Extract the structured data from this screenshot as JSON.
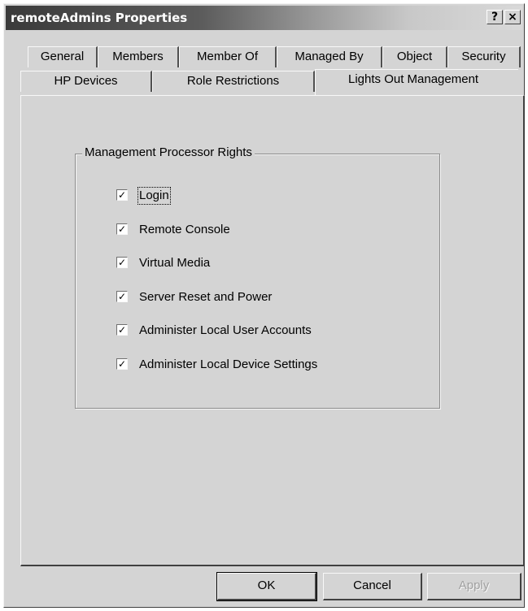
{
  "window": {
    "title": "remoteAdmins Properties",
    "help_label": "?",
    "close_label": "×"
  },
  "tabs": {
    "row1": [
      "General",
      "Members",
      "Member Of",
      "Managed By",
      "Object",
      "Security"
    ],
    "row2": [
      "HP Devices",
      "Role Restrictions",
      "Lights Out Management"
    ],
    "active": "Lights Out Management"
  },
  "group": {
    "label": "Management Processor Rights",
    "options": [
      {
        "label": "Login",
        "checked": true
      },
      {
        "label": "Remote Console",
        "checked": true
      },
      {
        "label": "Virtual Media",
        "checked": true
      },
      {
        "label": "Server Reset and Power",
        "checked": true
      },
      {
        "label": "Administer Local User Accounts",
        "checked": true
      },
      {
        "label": "Administer Local Device Settings",
        "checked": true
      }
    ]
  },
  "buttons": {
    "ok": "OK",
    "cancel": "Cancel",
    "apply": "Apply"
  },
  "colors": {
    "dialog_bg": "#d4d4d4",
    "disabled_text": "#a0a0a0"
  },
  "icons": {
    "check": "check-mark-icon"
  }
}
